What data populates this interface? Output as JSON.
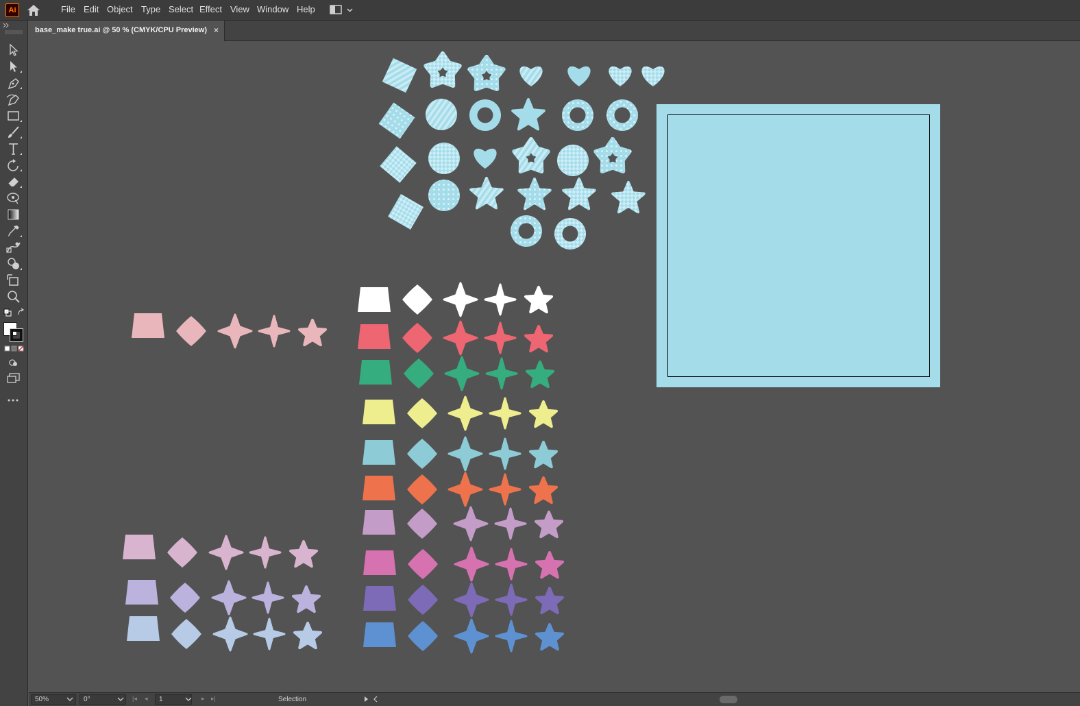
{
  "app": {
    "logo_text": "Ai",
    "brand_color": "#ff7c00"
  },
  "menu": [
    "File",
    "Edit",
    "Object",
    "Type",
    "Select",
    "Effect",
    "View",
    "Window",
    "Help"
  ],
  "document_tab": {
    "title": "base_make true.ai @ 50 % (CMYK/CPU Preview)",
    "close": "×"
  },
  "tools": [
    "selection-tool",
    "direct-selection-tool",
    "pen-tool",
    "curvature-tool",
    "rectangle-tool",
    "paintbrush-tool",
    "type-tool",
    "rotate-tool",
    "eraser-tool",
    "puppet-warp-tool",
    "gradient-tool",
    "eyedropper-tool",
    "blend-tool",
    "shape-builder-tool",
    "artboard-tool",
    "zoom-tool"
  ],
  "fill_stroke": {
    "fill_color": "#ffffff",
    "stroke_color": "#000000"
  },
  "status_bar": {
    "zoom": "50%",
    "rotation": "0°",
    "artboard_number": "1",
    "mode": "Selection"
  },
  "artboard": {
    "fill": "#a5dcea",
    "border": "#000000"
  },
  "pattern_color": "#a5dcea",
  "swatch_rows": [
    {
      "name": "white",
      "color": "#ffffff"
    },
    {
      "name": "coral-red",
      "color": "#ed6672"
    },
    {
      "name": "green",
      "color": "#36ad7f"
    },
    {
      "name": "yellow",
      "color": "#eeee8f"
    },
    {
      "name": "light-teal",
      "color": "#8dcbd6"
    },
    {
      "name": "orange",
      "color": "#ee734c"
    },
    {
      "name": "mauve",
      "color": "#c49cc8"
    },
    {
      "name": "pink",
      "color": "#d772b1"
    },
    {
      "name": "purple",
      "color": "#7e6bb7"
    },
    {
      "name": "blue",
      "color": "#5e91d1"
    }
  ],
  "left_rows": [
    {
      "name": "blush",
      "color": "#e9b6bb"
    },
    {
      "name": "lilac-pink",
      "color": "#d8b4ce"
    },
    {
      "name": "lavender",
      "color": "#bbb2dd"
    },
    {
      "name": "powder-blue",
      "color": "#b7cbe7"
    }
  ]
}
